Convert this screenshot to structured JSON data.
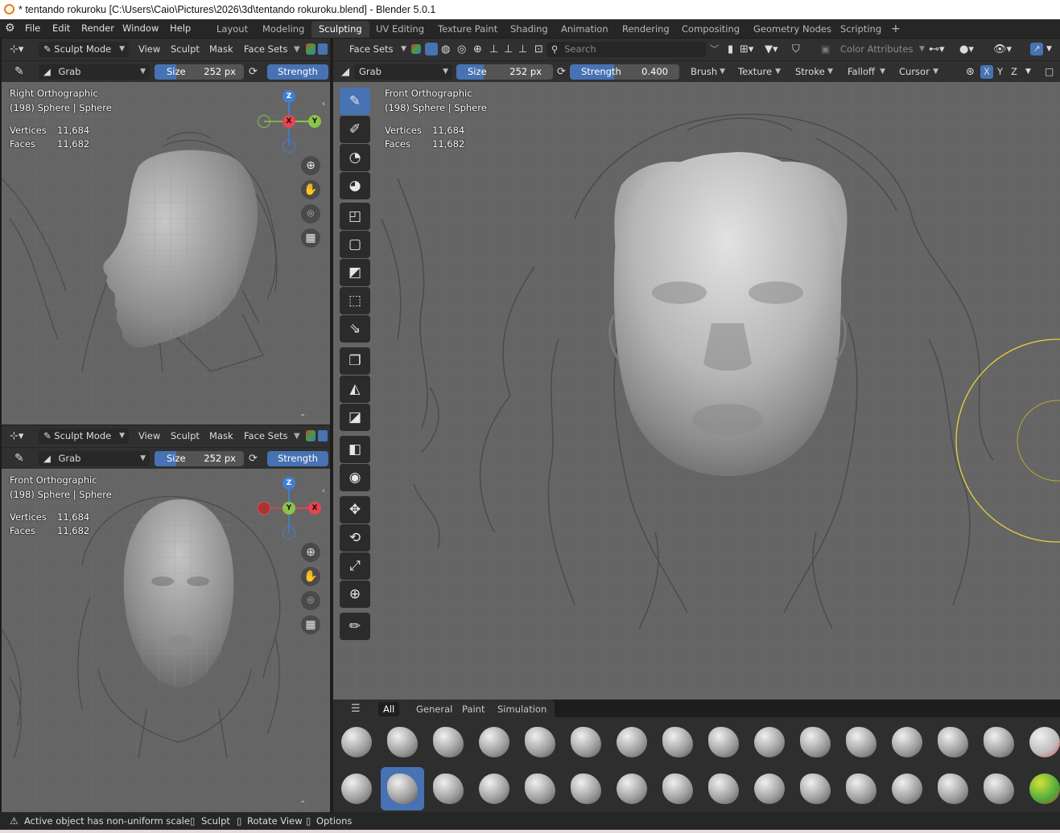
{
  "window": {
    "title": "* tentando rokuroku [C:\\Users\\Caio\\Pictures\\2026\\3d\\tentando rokuroku.blend] - Blender 5.0.1"
  },
  "menu": [
    "File",
    "Edit",
    "Render",
    "Window",
    "Help"
  ],
  "workspaces": [
    "Layout",
    "Modeling",
    "Sculpting",
    "UV Editing",
    "Texture Paint",
    "Shading",
    "Animation",
    "Rendering",
    "Compositing",
    "Geometry Nodes",
    "Scripting"
  ],
  "active_workspace": "Sculpting",
  "add_workspace": "+",
  "left_top": {
    "mode": "Sculpt Mode",
    "menus": [
      "View",
      "Sculpt",
      "Mask",
      "Face Sets"
    ],
    "brush": "Grab",
    "size_label": "Size",
    "size_value": "252 px",
    "strength_label": "Strength",
    "view_name": "Right Orthographic",
    "object": "(198) Sphere | Sphere",
    "vertices_label": "Vertices",
    "vertices": "11,684",
    "faces_label": "Faces",
    "faces": "11,682",
    "gizmo": {
      "top": "Z",
      "center": "X",
      "right": "Y"
    }
  },
  "left_bottom": {
    "mode": "Sculpt Mode",
    "menus": [
      "View",
      "Sculpt",
      "Mask",
      "Face Sets"
    ],
    "brush": "Grab",
    "size_label": "Size",
    "size_value": "252 px",
    "strength_label": "Strength",
    "view_name": "Front Orthographic",
    "object": "(198) Sphere | Sphere",
    "vertices_label": "Vertices",
    "vertices": "11,684",
    "faces_label": "Faces",
    "faces": "11,682",
    "gizmo": {
      "top": "Z",
      "center": "Y",
      "right": "X"
    }
  },
  "main": {
    "face_sets": "Face Sets",
    "search_placeholder": "Search",
    "color_attributes": "Color Attributes",
    "brush": "Grab",
    "size_label": "Size",
    "size_value": "252 px",
    "strength_label": "Strength",
    "strength_value": "0.400",
    "panels": [
      "Brush",
      "Texture",
      "Stroke",
      "Falloff",
      "Cursor"
    ],
    "axes": [
      "X",
      "Y",
      "Z"
    ],
    "view_name": "Front Orthographic",
    "object": "(198) Sphere | Sphere",
    "vertices_label": "Vertices",
    "vertices": "11,684",
    "faces_label": "Faces",
    "faces": "11,682",
    "shelf_tabs": [
      "All",
      "General",
      "Paint",
      "Simulation"
    ],
    "active_shelf_tab": "All"
  },
  "status": {
    "warning": "Active object has non-uniform scale",
    "hints": [
      "Sculpt",
      "Rotate View",
      "Options"
    ]
  },
  "colors": {
    "accent": "#4772b3",
    "viewport": "#656565",
    "header": "#303030",
    "axis_x": "#e8434f",
    "axis_y": "#8bc34a",
    "axis_z": "#3f7fd6",
    "brush_cursor": "#e8d23c"
  }
}
